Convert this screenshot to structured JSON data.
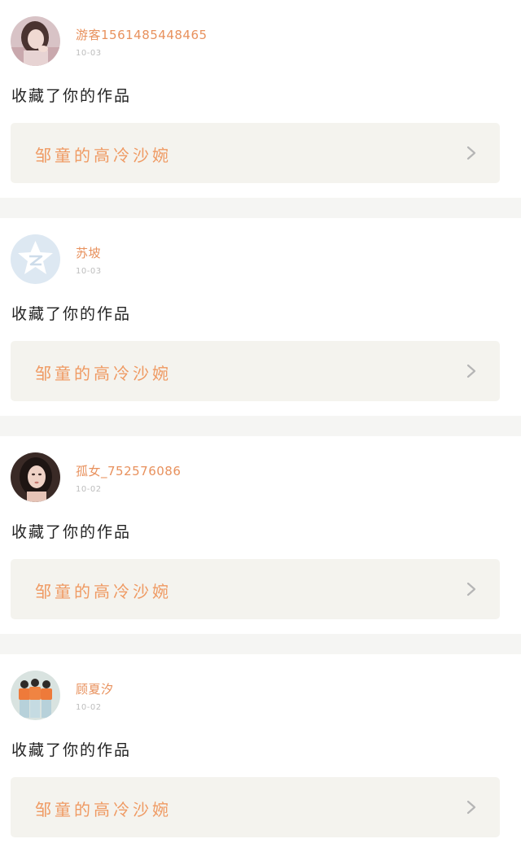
{
  "feed": {
    "items": [
      {
        "username": "游客1561485448465",
        "date": "10-03",
        "action": "收藏了你的作品",
        "work_title": "邹童的高冷沙婉",
        "avatar_icon": "girl-photo-avatar"
      },
      {
        "username": "苏坡",
        "date": "10-03",
        "action": "收藏了你的作品",
        "work_title": "邹童的高冷沙婉",
        "avatar_icon": "qzone-star-avatar"
      },
      {
        "username": "孤女_752576086",
        "date": "10-02",
        "action": "收藏了你的作品",
        "work_title": "邹童的高冷沙婉",
        "avatar_icon": "girl-photo-avatar"
      },
      {
        "username": "顾夏汐",
        "date": "10-02",
        "action": "收藏了你的作品",
        "work_title": "邹童的高冷沙婉",
        "avatar_icon": "group-photo-avatar"
      }
    ]
  },
  "colors": {
    "username": "#e8915d",
    "work_title": "#ef9a63",
    "card_bg": "#f4f3ee",
    "separator": "#f5f5f3",
    "action_text": "#222222",
    "date_text": "#bdbdbd"
  }
}
